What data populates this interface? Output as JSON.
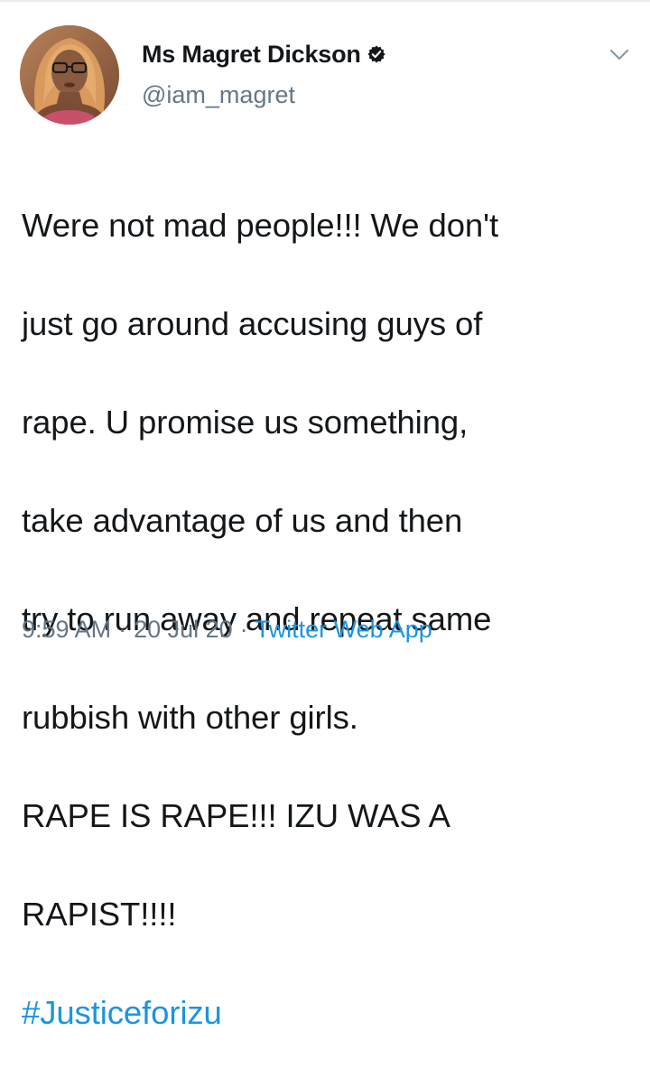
{
  "tweet": {
    "author": {
      "display_name": "Ms Magret Dickson",
      "handle": "@iam_magret",
      "verified_badge_icon": "verified-badge-icon",
      "avatar_icon": "avatar-photo"
    },
    "menu_icon": "chevron-down-icon",
    "text_lines": [
      "Were not mad people!!! We don't",
      "just go around accusing guys of",
      "rape. U promise us something,",
      "take advantage of us and then",
      "try to run away and repeat same",
      "rubbish with other girls.",
      "RAPE IS RAPE!!! IZU WAS A",
      "RAPIST!!!!"
    ],
    "hashtag": "#Justiceforizu",
    "meta": {
      "time": "9:59 AM",
      "separator": "·",
      "date": "20 Jul 20",
      "source": "Twitter Web App"
    }
  },
  "colors": {
    "text": "#14171a",
    "secondary": "#657786",
    "link": "#1b95e0",
    "divider": "#e6ecf0"
  }
}
